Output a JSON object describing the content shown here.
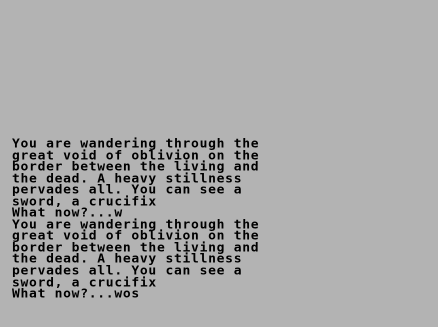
{
  "game": {
    "text_lines": [
      "You are wandering through the",
      "great void of oblivion on the",
      "border between the living and",
      "the dead. A heavy stillness",
      "pervades all. You can see a",
      "sword, a crucifix",
      "What now?...w",
      "You are wandering through the",
      "great void of oblivion on the",
      "border between the living and",
      "the dead. A heavy stillness",
      "pervades all. You can see a",
      "sword, a crucifix",
      "What now?...wos"
    ],
    "colors": {
      "background": "#b3b3b3",
      "text": "#000000"
    }
  }
}
